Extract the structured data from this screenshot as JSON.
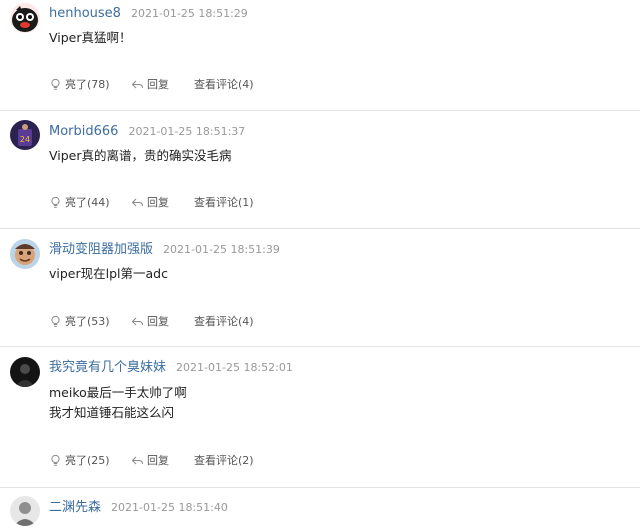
{
  "comments": [
    {
      "username": "henhouse8",
      "timestamp": "2021-01-25 18:51:29",
      "lines": [
        "Viper真猛啊！"
      ],
      "like_label": "亮了(78)",
      "reply_label": "回复",
      "view_label": "查看评论(4)",
      "avatar_icon": "cartoon-bird-avatar"
    },
    {
      "username": "Morbid666",
      "timestamp": "2021-01-25 18:51:37",
      "lines": [
        "Viper真的离谱，贵的确实没毛病"
      ],
      "like_label": "亮了(44)",
      "reply_label": "回复",
      "view_label": "查看评论(1)",
      "avatar_icon": "jersey-avatar"
    },
    {
      "username": "滑动变阻器加强版",
      "timestamp": "2021-01-25 18:51:39",
      "lines": [
        "viper现在lpl第一adc"
      ],
      "like_label": "亮了(53)",
      "reply_label": "回复",
      "view_label": "查看评论(4)",
      "avatar_icon": "cartoon-face-avatar"
    },
    {
      "username": "我究竟有几个臭妹妹",
      "timestamp": "2021-01-25 18:52:01",
      "lines": [
        "meiko最后一手太帅了啊",
        "我才知道锤石能这么闪"
      ],
      "like_label": "亮了(25)",
      "reply_label": "回复",
      "view_label": "查看评论(2)",
      "avatar_icon": "dark-figure-avatar"
    },
    {
      "username": "二渊先森",
      "timestamp": "2021-01-25 18:51:40",
      "lines": [],
      "like_label": "",
      "reply_label": "",
      "view_label": "",
      "avatar_icon": "person-photo-avatar"
    }
  ],
  "colors": {
    "username": "#3d6d9f",
    "timestamp": "#999999",
    "divider": "#e3e3e3"
  },
  "icons": {
    "like": "lightbulb-icon",
    "reply": "reply-arrow-icon"
  }
}
